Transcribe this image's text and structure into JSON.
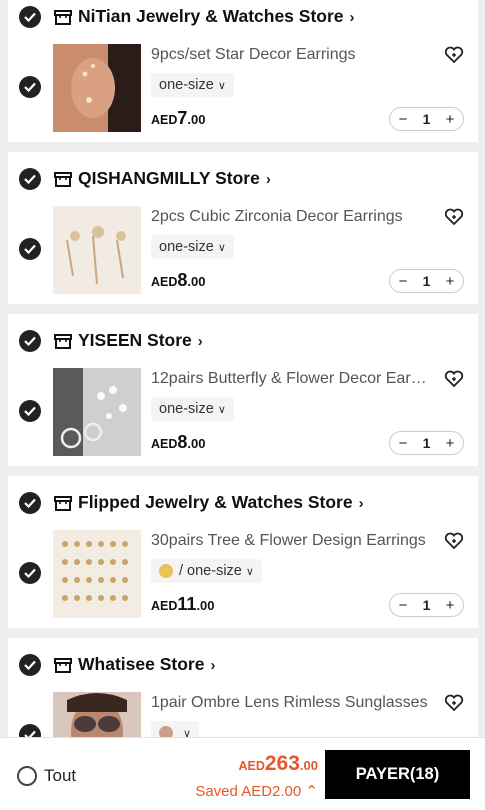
{
  "stores": [
    {
      "name": "NiTian Jewelry & Watches Store",
      "item": {
        "title": "9pcs/set Star Decor Earrings",
        "variant": "one-size",
        "swatch": "",
        "currency": "AED",
        "price_int": "7",
        "price_dec": ".00",
        "qty": "1"
      }
    },
    {
      "name": "QISHANGMILLY Store",
      "item": {
        "title": "2pcs Cubic Zirconia Decor Earrings",
        "variant": "one-size",
        "swatch": "",
        "currency": "AED",
        "price_int": "8",
        "price_dec": ".00",
        "qty": "1"
      }
    },
    {
      "name": "YISEEN Store",
      "item": {
        "title": "12pairs Butterfly & Flower Decor Earrings",
        "variant": "one-size",
        "swatch": "",
        "currency": "AED",
        "price_int": "8",
        "price_dec": ".00",
        "qty": "1"
      }
    },
    {
      "name": "Flipped Jewelry & Watches Store",
      "item": {
        "title": "30pairs Tree & Flower Design Earrings",
        "variant": "/ one-size",
        "swatch": "#e8c35a",
        "currency": "AED",
        "price_int": "11",
        "price_dec": ".00",
        "qty": "1"
      }
    },
    {
      "name": "Whatisee Store",
      "item": {
        "title": "1pair Ombre Lens Rimless Sunglasses",
        "variant": "",
        "swatch": "#c8a08e",
        "currency": "",
        "price_int": "",
        "price_dec": "",
        "qty": ""
      }
    }
  ],
  "bottom": {
    "all_label": "Tout",
    "total_currency": "AED",
    "total_int": "263",
    "total_dec": ".00",
    "saved": "Saved AED2.00",
    "saved_chevron": "⌃",
    "pay_label": "PAYER(18)"
  },
  "icons": {
    "check": "check-icon",
    "store": "store-icon",
    "wishlist": "heart-plus-icon",
    "chevron_right": "chevron-right-icon",
    "chevron_down": "chevron-down-icon"
  },
  "colors": {
    "accent": "#e8572a",
    "pay_button": "#000000",
    "check_fill": "#222222"
  }
}
